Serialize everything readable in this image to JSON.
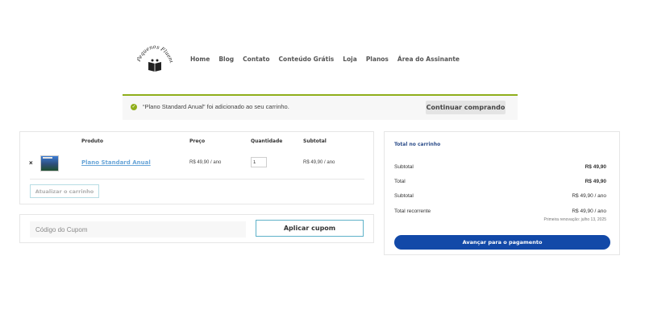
{
  "header": {
    "logo_text": "Pequenos Fluentes",
    "nav": [
      "Home",
      "Blog",
      "Contato",
      "Conteúdo Grátis",
      "Loja",
      "Planos",
      "Área do Assinante"
    ]
  },
  "notice": {
    "message": "“Plano Standard Anual” foi adicionado ao seu carrinho.",
    "button": "Continuar comprando",
    "accent_color": "#8fae1b"
  },
  "cart": {
    "columns": [
      "Produto",
      "Preço",
      "Quantidade",
      "Subtotal"
    ],
    "item": {
      "remove": "×",
      "product": "Plano Standard Anual",
      "price": "R$ 49,90 / ano",
      "quantity": "1",
      "subtotal": "R$ 49,90 / ano"
    },
    "update_button": "Atualizar o carrinho"
  },
  "coupon": {
    "placeholder": "Código do Cupom",
    "button": "Aplicar cupom"
  },
  "totals": {
    "title": "Total no carrinho",
    "subtotal_label": "Subtotal",
    "subtotal_value": "R$ 49,90",
    "total_label": "Total",
    "total_value": "R$ 49,90",
    "recurring_subtotal_label": "Subtotal",
    "recurring_subtotal_value": "R$ 49,90 / ano",
    "recurring_total_label": "Total recorrente",
    "recurring_total_value": "R$ 49,90 / ano",
    "renewal": "Primeira renovação: julho 13, 2025",
    "checkout_button": "Avançar para o pagamento",
    "accent_color": "#1249a8"
  }
}
